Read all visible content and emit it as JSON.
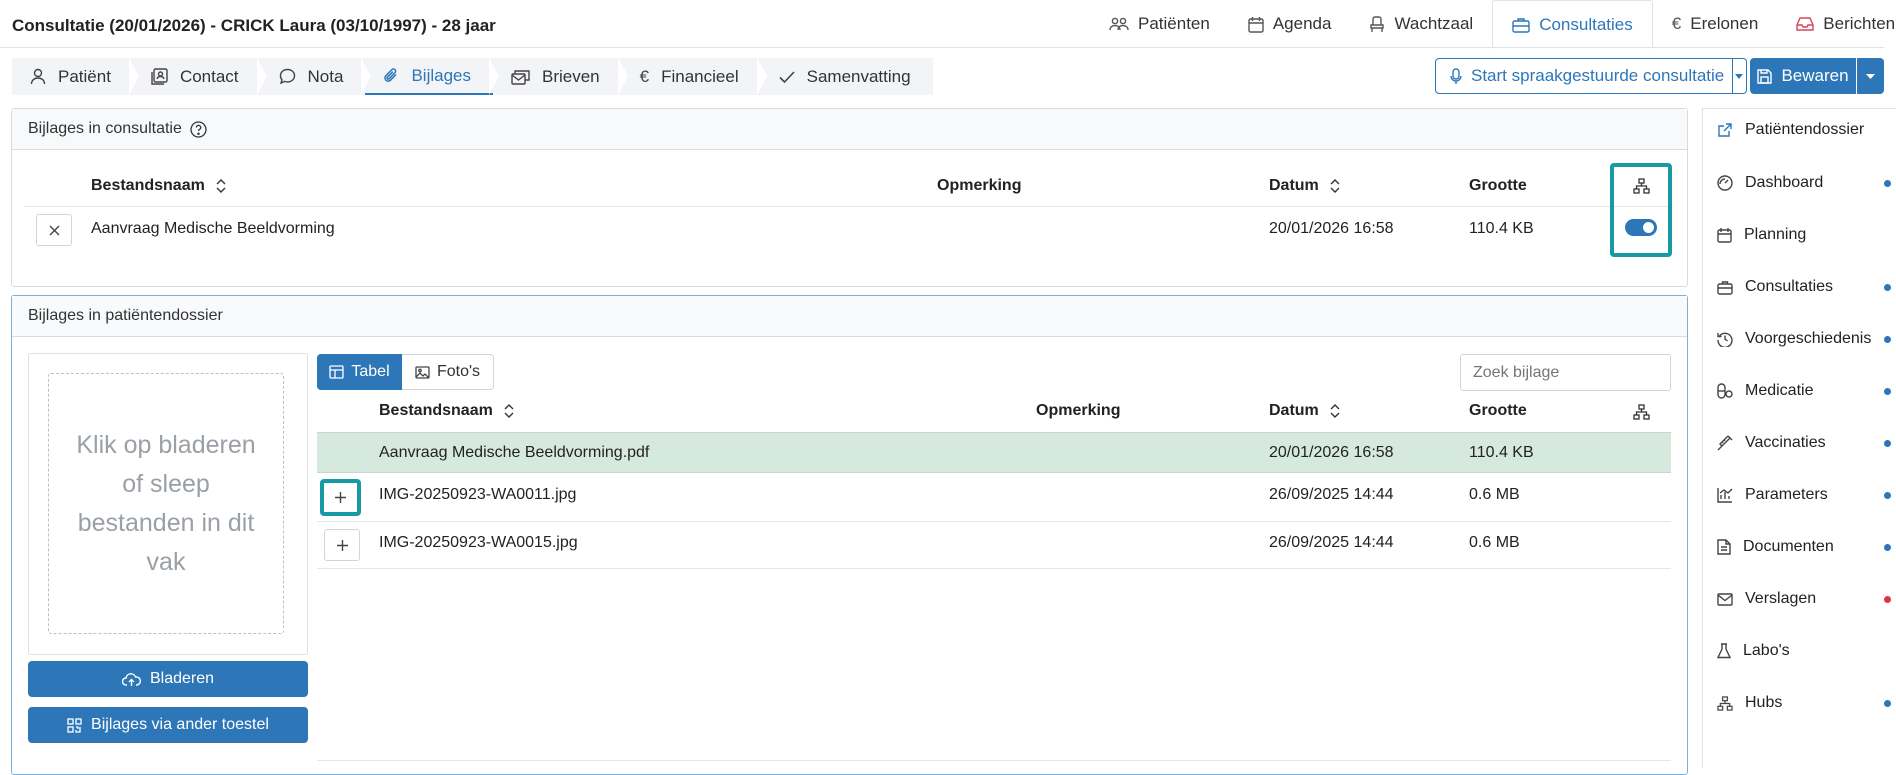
{
  "header": {
    "title": "Consultatie (20/01/2026) - CRICK Laura (03/10/1997) - 28 jaar",
    "nav": [
      {
        "label": "Patiënten",
        "icon": "users-icon"
      },
      {
        "label": "Agenda",
        "icon": "calendar-icon"
      },
      {
        "label": "Wachtzaal",
        "icon": "chair-icon"
      },
      {
        "label": "Consultaties",
        "icon": "briefcase-icon",
        "active": true
      },
      {
        "label": "Erelonen",
        "icon": "euro-icon"
      },
      {
        "label": "Berichten",
        "icon": "inbox-icon"
      }
    ]
  },
  "subtabs": [
    {
      "label": "Patiënt",
      "icon": "user-icon"
    },
    {
      "label": "Contact",
      "icon": "contact-icon"
    },
    {
      "label": "Nota",
      "icon": "chat-icon"
    },
    {
      "label": "Bijlages",
      "icon": "paperclip-icon",
      "active": true
    },
    {
      "label": "Brieven",
      "icon": "letters-icon"
    },
    {
      "label": "Financieel",
      "icon": "euro-icon"
    },
    {
      "label": "Samenvatting",
      "icon": "check-icon"
    }
  ],
  "actions": {
    "voice_label": "Start spraakgestuurde consultatie",
    "save_label": "Bewaren"
  },
  "consult_attachments": {
    "title": "Bijlages in consultatie",
    "columns": {
      "name": "Bestandsnaam",
      "remark": "Opmerking",
      "date": "Datum",
      "size": "Grootte"
    },
    "rows": [
      {
        "name": "Aanvraag Medische Beeldvorming",
        "remark": "",
        "date": "20/01/2026 16:58",
        "size": "110.4 KB",
        "shared": true
      }
    ]
  },
  "patient_attachments": {
    "title": "Bijlages in patiëntendossier",
    "dropzone_text": "Klik op bladeren of sleep bestanden in dit vak",
    "browse_label": "Bladeren",
    "other_device_label": "Bijlages via ander toestel",
    "view_tabs": {
      "table": "Tabel",
      "photos": "Foto's"
    },
    "search_placeholder": "Zoek bijlage",
    "columns": {
      "name": "Bestandsnaam",
      "remark": "Opmerking",
      "date": "Datum",
      "size": "Grootte"
    },
    "rows": [
      {
        "name": "Aanvraag Medische Beeldvorming.pdf",
        "remark": "",
        "date": "20/01/2026 16:58",
        "size": "110.4 KB",
        "linked": true
      },
      {
        "name": "IMG-20250923-WA0011.jpg",
        "remark": "",
        "date": "26/09/2025 14:44",
        "size": "0.6 MB",
        "linked": false
      },
      {
        "name": "IMG-20250923-WA0015.jpg",
        "remark": "",
        "date": "26/09/2025 14:44",
        "size": "0.6 MB",
        "linked": false
      }
    ]
  },
  "sidebar": {
    "items": [
      {
        "label": "Patiëntendossier",
        "icon": "external-link-icon",
        "dot": "",
        "accent": true
      },
      {
        "label": "Dashboard",
        "icon": "dashboard-icon",
        "dot": "#2d77b8"
      },
      {
        "label": "Planning",
        "icon": "calendar-icon",
        "dot": ""
      },
      {
        "label": "Consultaties",
        "icon": "briefcase-icon",
        "dot": "#2d77b8"
      },
      {
        "label": "Voorgeschiedenis",
        "icon": "history-icon",
        "dot": "#2d77b8"
      },
      {
        "label": "Medicatie",
        "icon": "pill-icon",
        "dot": "#2d77b8"
      },
      {
        "label": "Vaccinaties",
        "icon": "syringe-icon",
        "dot": "#2d77b8"
      },
      {
        "label": "Parameters",
        "icon": "chart-icon",
        "dot": "#2d77b8"
      },
      {
        "label": "Documenten",
        "icon": "document-icon",
        "dot": "#2d77b8"
      },
      {
        "label": "Verslagen",
        "icon": "mail-icon",
        "dot": "#e0334a"
      },
      {
        "label": "Labo's",
        "icon": "flask-icon",
        "dot": ""
      },
      {
        "label": "Hubs",
        "icon": "hub-icon",
        "dot": "#2d77b8"
      }
    ]
  },
  "colors": {
    "accent": "#2d77b8",
    "highlight": "#179aa3",
    "selected_row": "#d6e9df"
  }
}
